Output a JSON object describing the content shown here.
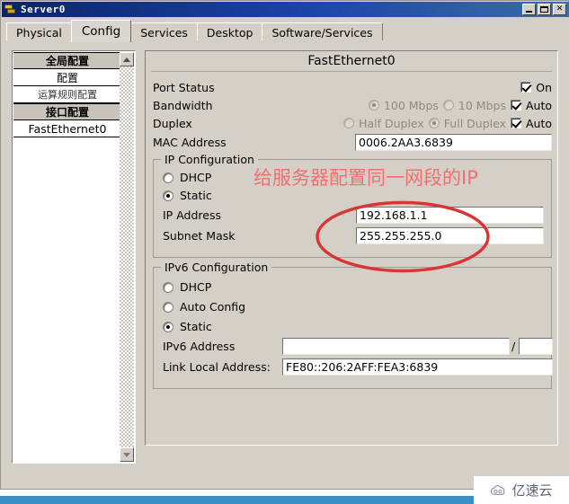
{
  "window": {
    "title": "Server0",
    "icon": "server-icon",
    "buttons": {
      "minimize": "_",
      "maximize": "□",
      "close": "×"
    }
  },
  "tabs": [
    {
      "label": "Physical",
      "active": false
    },
    {
      "label": "Config",
      "active": true
    },
    {
      "label": "Services",
      "active": false
    },
    {
      "label": "Desktop",
      "active": false
    },
    {
      "label": "Software/Services",
      "active": false
    }
  ],
  "sidebar": {
    "items": [
      {
        "label": "全局配置",
        "type": "header"
      },
      {
        "label": "配置",
        "type": "item"
      },
      {
        "label": "运算规则配置",
        "type": "item-small"
      },
      {
        "label": "接口配置",
        "type": "header"
      },
      {
        "label": "FastEthernet0",
        "type": "leaf"
      }
    ],
    "scroll_up_icon": "scroll-up-arrow-icon",
    "scroll_down_icon": "scroll-down-arrow-icon"
  },
  "panel": {
    "title": "FastEthernet0",
    "port_status": {
      "label": "Port Status",
      "on_label": "On",
      "on_checked": true
    },
    "bandwidth": {
      "label": "Bandwidth",
      "option_100": "100 Mbps",
      "option_10": "10 Mbps",
      "selected": "100 Mbps",
      "auto_label": "Auto",
      "auto_checked": true
    },
    "duplex": {
      "label": "Duplex",
      "option_half": "Half Duplex",
      "option_full": "Full Duplex",
      "selected": "Full Duplex",
      "auto_label": "Auto",
      "auto_checked": true
    },
    "mac": {
      "label": "MAC Address",
      "value": "0006.2AA3.6839"
    },
    "ip_config": {
      "title": "IP Configuration",
      "dhcp_label": "DHCP",
      "static_label": "Static",
      "selected": "Static",
      "ip_address_label": "IP Address",
      "ip_address_value": "192.168.1.1",
      "subnet_mask_label": "Subnet Mask",
      "subnet_mask_value": "255.255.255.0"
    },
    "ipv6_config": {
      "title": "IPv6 Configuration",
      "dhcp_label": "DHCP",
      "auto_config_label": "Auto Config",
      "static_label": "Static",
      "selected": "Static",
      "ipv6_address_label": "IPv6 Address",
      "ipv6_address_value": "",
      "ipv6_prefix_value": "",
      "slash": "/",
      "link_local_label": "Link Local Address:",
      "link_local_value": "FE80::206:2AFF:FEA3:6839"
    }
  },
  "annotation": {
    "text": "给服务器配置同一网段的IP",
    "text_color": "#ef7070",
    "ellipse_color": "#d93535"
  },
  "watermark": {
    "text": "亿速云",
    "icon": "cloud-icon"
  }
}
